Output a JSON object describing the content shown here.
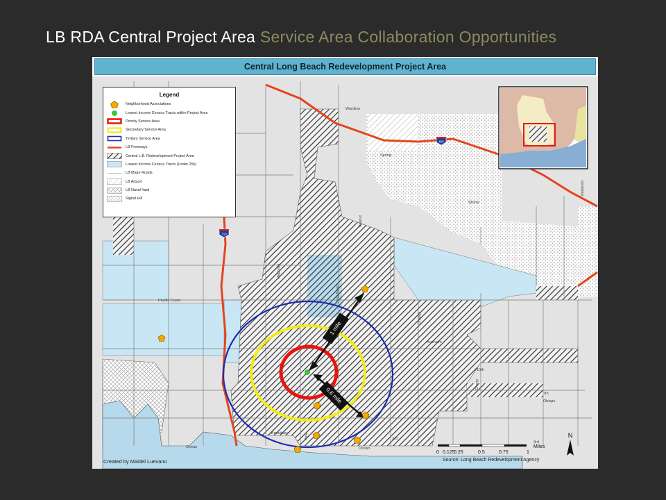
{
  "slide": {
    "title_main": "LB RDA Central Project Area",
    "title_accent": "Service Area Collaboration Opportunities"
  },
  "map": {
    "header": "Central Long Beach Redevelopment Project Area",
    "legend": {
      "title": "Legend",
      "items": [
        {
          "label": "Neighborhood Associations",
          "symbol": "pentagon-icon"
        },
        {
          "label": "Lowest Income Census Tracts within Project Area",
          "symbol": "green-dot-icon"
        },
        {
          "label": "Priority Service Area",
          "symbol": "red-box-icon"
        },
        {
          "label": "Secondary Service Area",
          "symbol": "yellow-box-icon"
        },
        {
          "label": "Tertiary Service Area",
          "symbol": "blue-box-icon"
        },
        {
          "label": "LB Freeways",
          "symbol": "red-line-icon"
        },
        {
          "label": "Central L.B. Redevelopment Project Area",
          "symbol": "hatch-icon"
        },
        {
          "label": "Lowest Income Census Tracts (Under 25k)",
          "symbol": "lightblue-box-icon"
        },
        {
          "label": "LB Major Roads",
          "symbol": "thin-line-icon"
        },
        {
          "label": "LB Airport",
          "symbol": "light-hatch-icon"
        },
        {
          "label": "LB Naval Yard",
          "symbol": "crosshatch-icon"
        },
        {
          "label": "Signal Hill",
          "symbol": "dots-icon"
        }
      ]
    },
    "street_labels": {
      "willow": "Willow",
      "spring": "Spring",
      "wardlow": "Wardlow",
      "pacific_coast": "Pacific Coast",
      "magnolia": "Magnolia",
      "long_beach": "Long Beach",
      "orange": "Orange",
      "cherry": "Cherry",
      "tenth": "10th",
      "seventh": "7th",
      "obispo": "Obispo",
      "third": "3rd",
      "broadway": "Broadway",
      "ocean": "Ocean",
      "redondo": "Redondo",
      "pine": "Pine",
      "ocean_bay": "Ocean",
      "walnut": "Walnut",
      "anaheim": "Anaheim",
      "third_w": "3rd"
    },
    "shields": {
      "i405": "405",
      "i710": "710"
    },
    "measures": {
      "one_mile": "1 mile",
      "half_mile": "0.6 mile"
    },
    "scale_bar": {
      "ticks": [
        "0",
        "0.125",
        "0.25",
        "0.5",
        "0.75",
        "1"
      ],
      "unit": "Miles"
    },
    "north_arrow": "N",
    "credit": "Created by Maidel Luevano",
    "source": "Source: Long Beach Redevelopment Agency"
  },
  "colors": {
    "priority": "#e8140f",
    "secondary": "#f3ea1a",
    "tertiary": "#1b2db0",
    "freeway": "#e3451e",
    "low_income": "#c9e6f5",
    "neighborhood": "#f2a900",
    "lowest_tract": "#2bd12b"
  }
}
